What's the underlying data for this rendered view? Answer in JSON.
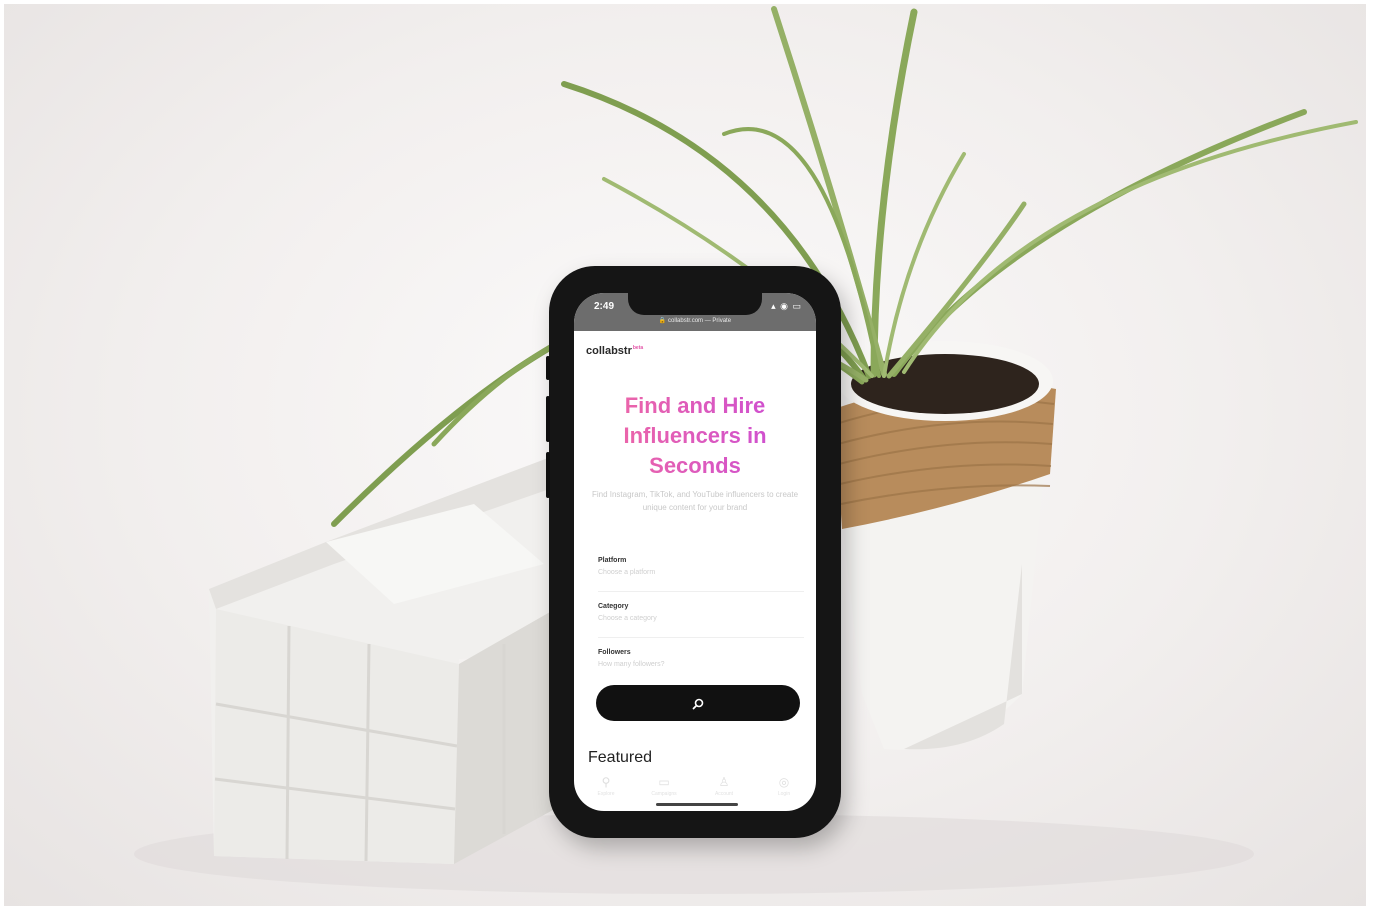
{
  "phone": {
    "status_time": "2:49",
    "status_icons": "▴ ◉ ▭",
    "url": "🔒 collabstr.com — Private",
    "brand": "collabstr",
    "brand_badge": "beta",
    "headline": "Find and Hire Influencers in Seconds",
    "subheadline": "Find Instagram, TikTok, and YouTube influencers to create unique content for your brand",
    "fields": [
      {
        "label": "Platform",
        "placeholder": "Choose a platform"
      },
      {
        "label": "Category",
        "placeholder": "Choose a category"
      },
      {
        "label": "Followers",
        "placeholder": "How many followers?"
      }
    ],
    "search_icon": "search-icon",
    "featured": "Featured",
    "tabs": [
      {
        "icon": "search-icon",
        "label": "Explore"
      },
      {
        "icon": "briefcase-icon",
        "label": "Campaigns"
      },
      {
        "icon": "person-icon",
        "label": "Account"
      },
      {
        "icon": "globe-icon",
        "label": "Login"
      }
    ]
  },
  "colors": {
    "headline_start": "#f26aa0",
    "headline_end": "#c94bd8",
    "phone_body": "#151515",
    "pot_rope": "#b88c5c",
    "plant_leaf": "#8aa85a"
  }
}
